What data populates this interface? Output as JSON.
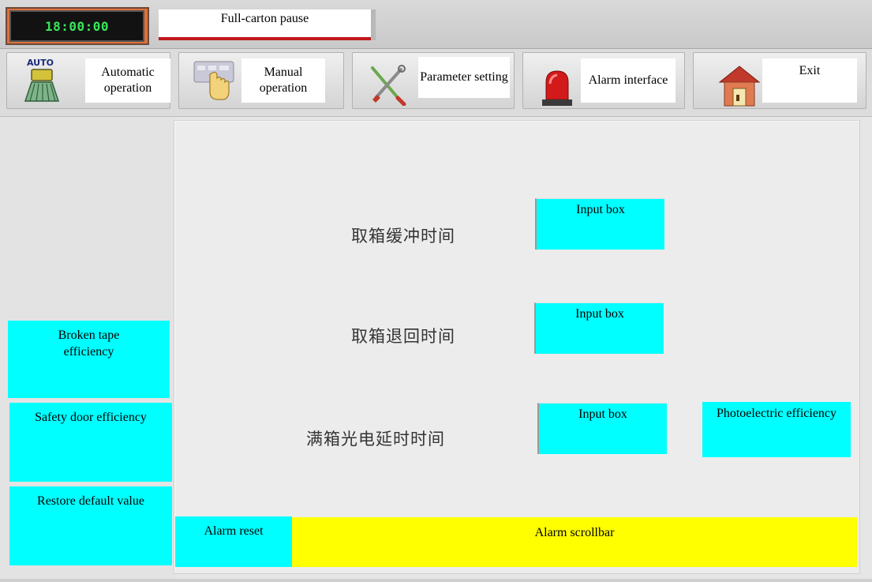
{
  "header": {
    "clock": "18:00:00",
    "status_message": "Full-carton pause"
  },
  "nav": {
    "items": [
      {
        "label": "Automatic operation",
        "icon": "auto-mode-icon",
        "badge": "AUTO"
      },
      {
        "label": "Manual operation",
        "icon": "hand-press-icon"
      },
      {
        "label": "Parameter setting",
        "icon": "tools-icon"
      },
      {
        "label": "Alarm interface",
        "icon": "alarm-light-icon"
      },
      {
        "label": "Exit",
        "icon": "house-exit-icon"
      }
    ]
  },
  "sidebar": {
    "buttons": [
      {
        "label": "Broken tape efficiency"
      },
      {
        "label": "Safety door efficiency"
      },
      {
        "label": "Restore default value"
      }
    ]
  },
  "params": [
    {
      "label": "取箱缓冲时间",
      "input": "Input box"
    },
    {
      "label": "取箱退回时间",
      "input": "Input box"
    },
    {
      "label": "满箱光电延时时间",
      "input": "Input box"
    }
  ],
  "photoelectric_button": "Photoelectric efficiency",
  "footer": {
    "alarm_reset": "Alarm reset",
    "alarm_scrollbar": "Alarm scrollbar"
  },
  "colors": {
    "button_cyan": "#00ffff",
    "scrollbar_yellow": "#ffff00",
    "clock_green": "#39e65b",
    "status_underline": "#c0161c"
  }
}
